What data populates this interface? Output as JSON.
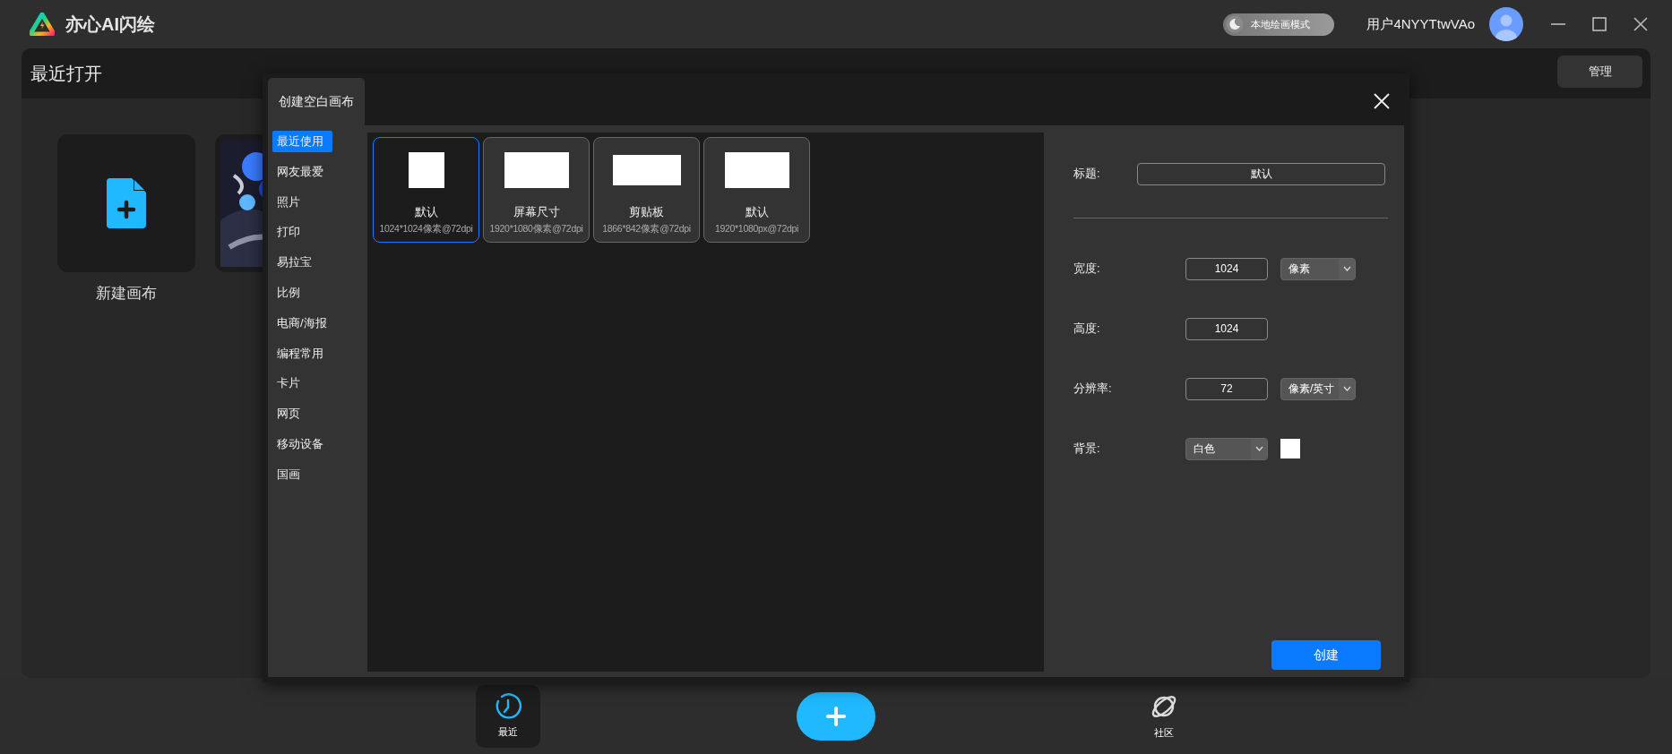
{
  "app": {
    "title": "亦心AI闪绘"
  },
  "mode_toggle": {
    "label": "本地绘画模式",
    "on": false
  },
  "user": {
    "name": "用户4NYYTtwVAo"
  },
  "recent": {
    "title": "最近打开",
    "manage_button": "管理",
    "items": [
      {
        "kind": "new",
        "label": "新建画布"
      },
      {
        "kind": "picture"
      }
    ]
  },
  "dialog": {
    "tab": "创建空白画布",
    "categories": [
      {
        "label": "最近使用",
        "selected": true
      },
      {
        "label": "网友最爱",
        "selected": false
      },
      {
        "label": "照片",
        "selected": false
      },
      {
        "label": "打印",
        "selected": false
      },
      {
        "label": "易拉宝",
        "selected": false
      },
      {
        "label": "比例",
        "selected": false
      },
      {
        "label": "电商/海报",
        "selected": false
      },
      {
        "label": "编程常用",
        "selected": false
      },
      {
        "label": "卡片",
        "selected": false
      },
      {
        "label": "网页",
        "selected": false
      },
      {
        "label": "移动设备",
        "selected": false
      },
      {
        "label": "国画",
        "selected": false
      }
    ],
    "presets": [
      {
        "kind": "square",
        "name": "默认",
        "spec": "1024*1024像素@72dpi",
        "selected": true
      },
      {
        "kind": "screen",
        "name": "屏幕尺寸",
        "spec": "1920*1080像素@72dpi",
        "selected": false
      },
      {
        "kind": "wide",
        "name": "剪贴板",
        "spec": "1866*842像素@72dpi",
        "selected": false
      },
      {
        "kind": "screen",
        "name": "默认",
        "spec": "1920*1080px@72dpi",
        "selected": false
      }
    ],
    "settings": {
      "title_label": "标题:",
      "title_value": "默认",
      "width_label": "宽度:",
      "width_value": "1024",
      "width_unit": "像素",
      "height_label": "高度:",
      "height_value": "1024",
      "resolution_label": "分辨率:",
      "resolution_value": "72",
      "resolution_unit": "像素/英寸",
      "background_label": "背景:",
      "background_value": "白色"
    },
    "create_button": "创建"
  },
  "bottom_nav": [
    {
      "kind": "recent",
      "label": "最近",
      "selected": true
    },
    {
      "kind": "add"
    },
    {
      "kind": "community",
      "label": "社区",
      "selected": false
    }
  ]
}
